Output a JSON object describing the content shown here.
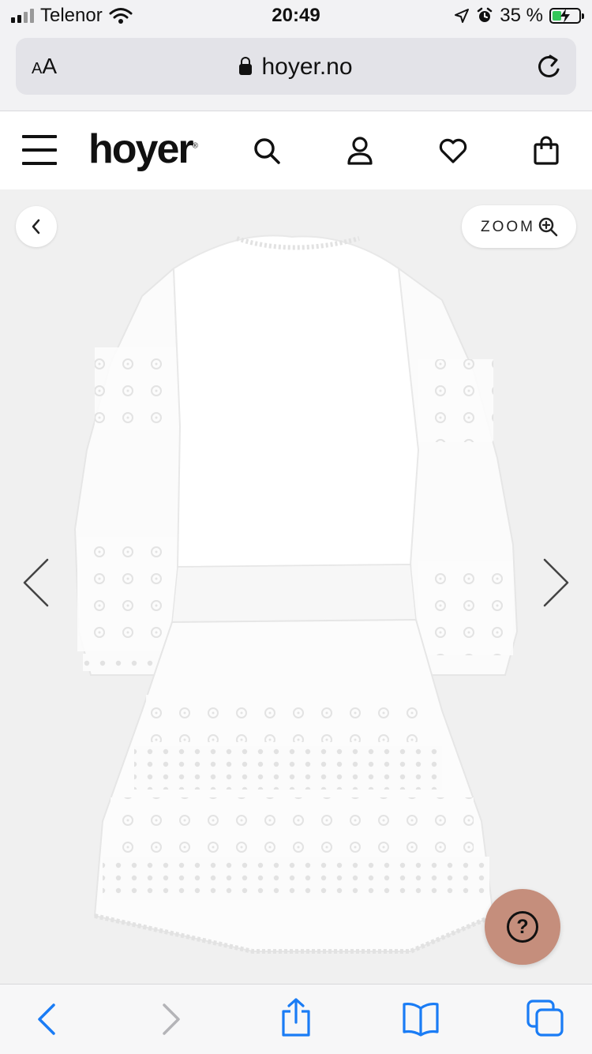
{
  "status_bar": {
    "carrier": "Telenor",
    "time": "20:49",
    "battery_percent": "35 %",
    "battery_level": 0.35,
    "icons": [
      "signal-bars-icon",
      "wifi-icon",
      "location-arrow-icon",
      "alarm-icon",
      "battery-charging-icon"
    ]
  },
  "browser": {
    "text_size_label": "A",
    "text_size_label_large": "A",
    "domain": "hoyer.no",
    "icons": [
      "lock-icon",
      "reload-icon"
    ]
  },
  "site_header": {
    "logo_text": "hoyer",
    "logo_mark": "®",
    "icons": [
      "hamburger-menu-icon",
      "search-icon",
      "account-icon",
      "wishlist-heart-icon",
      "shopping-bag-icon"
    ]
  },
  "gallery": {
    "zoom_label": "ZOOM",
    "help_label": "?",
    "icons": [
      "chevron-left-icon",
      "zoom-in-icon",
      "prev-arrow-icon",
      "next-arrow-icon",
      "help-icon"
    ]
  },
  "toolbar": {
    "icons": [
      "back-icon",
      "forward-icon",
      "share-icon",
      "bookmarks-icon",
      "tabs-icon"
    ]
  },
  "colors": {
    "help_button": "#c58e7c",
    "safari_blue": "#1a7cf5",
    "disabled_gray": "#b4b4b8",
    "gallery_background": "#f0f0f0",
    "battery_green": "#34c759"
  }
}
